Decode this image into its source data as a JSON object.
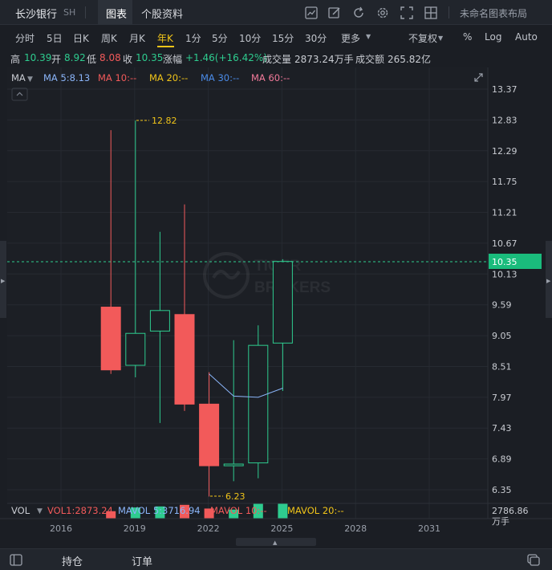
{
  "stock": {
    "name": "长沙银行",
    "exchange": "SH"
  },
  "header_tabs": [
    "图表",
    "个股资料"
  ],
  "layout_name": "未命名图表布局",
  "toolbar_icons": [
    "chart-icon",
    "pen-icon",
    "refresh-icon",
    "settings-icon",
    "fullscreen-icon",
    "grid-icon"
  ],
  "timeframes": [
    "分时",
    "5日",
    "日K",
    "周K",
    "月K",
    "年K",
    "1分",
    "5分",
    "10分",
    "15分",
    "30分",
    "更多"
  ],
  "active_timeframe": "年K",
  "right_options": [
    "不复权",
    "%",
    "Log",
    "Auto"
  ],
  "quote": [
    {
      "label": "高",
      "value": "10.39"
    },
    {
      "label": "开",
      "value": "8.92"
    },
    {
      "label": "低",
      "value": "8.08"
    },
    {
      "label": "收",
      "value": "10.35"
    },
    {
      "label": "涨幅",
      "value": "+1.46(+16.42%)"
    },
    {
      "label": "成交量",
      "value": "2873.24万手"
    },
    {
      "label": "成交额",
      "value": "265.82亿"
    }
  ],
  "ma_legend": {
    "title": "MA",
    "items": [
      "MA 5:8.13",
      "MA 10:--",
      "MA 20:--",
      "MA 30:--",
      "MA 60:--"
    ]
  },
  "vol_legend": {
    "title": "VOL",
    "items": [
      "VOL1:2873.24",
      "MAVOL 5:3716.94",
      "MAVOL 10:--",
      "MAVOL 20:--"
    ]
  },
  "watermark": "TIGER BROKERS",
  "colors": {
    "up": "#2ecc8f",
    "down": "#f25a5a",
    "ma5": "#8ab4f8",
    "bg": "#1b1e24",
    "accent": "#f0c419",
    "price_tag": "#1abc7c"
  },
  "chart_data": {
    "type": "candlestick",
    "x_tick_labels": [
      "2016",
      "2019",
      "2022",
      "2025",
      "2028",
      "2031"
    ],
    "y_tick_labels": [
      "13.37",
      "12.83",
      "12.29",
      "11.75",
      "11.21",
      "10.67",
      "10.13",
      "9.59",
      "9.05",
      "8.51",
      "7.97",
      "7.43",
      "6.89",
      "6.35"
    ],
    "ylim": [
      6.35,
      13.37
    ],
    "candles": [
      {
        "year": 2018,
        "open": 9.55,
        "high": 12.65,
        "low": 8.38,
        "close": 8.45
      },
      {
        "year": 2019,
        "open": 8.53,
        "high": 12.82,
        "low": 8.32,
        "close": 9.09
      },
      {
        "year": 2020,
        "open": 9.13,
        "high": 10.87,
        "low": 7.52,
        "close": 9.49
      },
      {
        "year": 2021,
        "open": 9.42,
        "high": 11.35,
        "low": 7.73,
        "close": 7.85
      },
      {
        "year": 2022,
        "open": 7.85,
        "high": 8.41,
        "low": 6.23,
        "close": 6.77
      },
      {
        "year": 2023,
        "open": 6.77,
        "high": 8.97,
        "low": 6.5,
        "close": 6.8
      },
      {
        "year": 2024,
        "open": 6.82,
        "high": 9.23,
        "low": 6.55,
        "close": 8.88
      },
      {
        "year": 2025,
        "open": 8.92,
        "high": 10.39,
        "low": 8.08,
        "close": 10.35
      }
    ],
    "ma5": [
      {
        "year": 2022,
        "value": 8.38
      },
      {
        "year": 2023,
        "value": 7.99
      },
      {
        "year": 2024,
        "value": 7.97
      },
      {
        "year": 2025,
        "value": 8.13
      }
    ],
    "volume": [
      {
        "year": 2018,
        "dir": "down",
        "value": 1400
      },
      {
        "year": 2019,
        "dir": "up",
        "value": 2100
      },
      {
        "year": 2020,
        "dir": "up",
        "value": 2300
      },
      {
        "year": 2021,
        "dir": "down",
        "value": 2600
      },
      {
        "year": 2022,
        "dir": "down",
        "value": 1900
      },
      {
        "year": 2023,
        "dir": "up",
        "value": 1700
      },
      {
        "year": 2024,
        "dir": "up",
        "value": 2786.86
      },
      {
        "year": 2025,
        "dir": "up",
        "value": 2873.24
      }
    ],
    "current_price": "10.35",
    "high_label": "12.82",
    "low_label": "6.23",
    "vol_axis_label": "2786.86",
    "vol_unit": "万手"
  },
  "bottom_tabs": [
    "持仓",
    "订单"
  ]
}
